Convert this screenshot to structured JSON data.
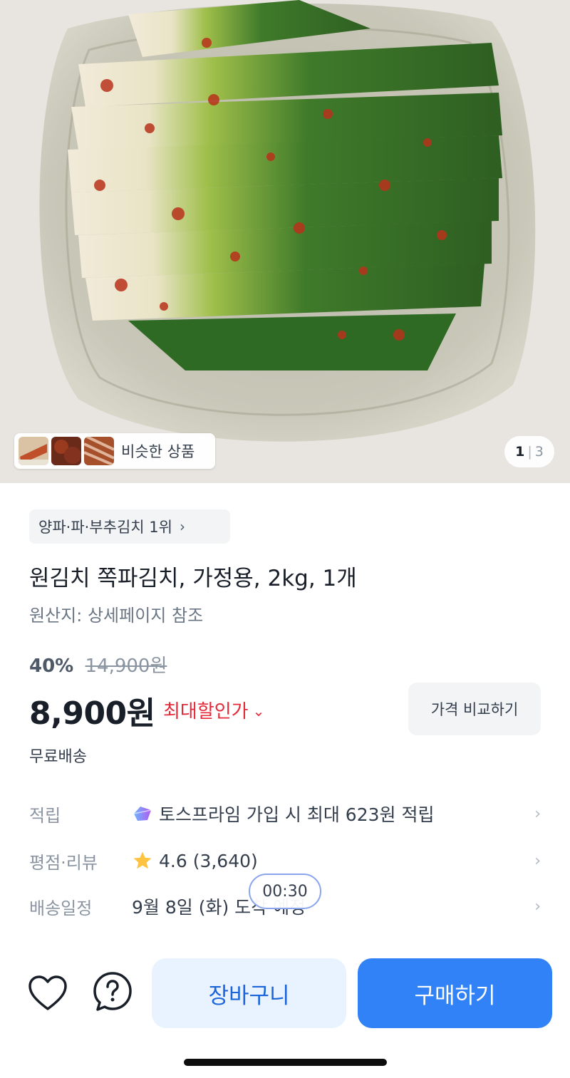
{
  "gallery": {
    "similar_label": "비슷한 상품",
    "current_index": "1",
    "separator": "|",
    "total": "3"
  },
  "product": {
    "category_rank": "양파·파·부추김치 1위",
    "title": "원김치 쪽파김치, 가정용, 2kg, 1개",
    "origin": "원산지: 상세페이지 참조",
    "discount_rate": "40%",
    "original_price": "14,900원",
    "price": "8,900원",
    "max_discount_label": "최대할인가",
    "compare_button": "가격 비교하기",
    "shipping": "무료배송"
  },
  "info_rows": [
    {
      "label": "적립",
      "value": "토스프라임 가입 시 최대 623원 적립",
      "icon": "toss-prime-gem-icon"
    },
    {
      "label": "평점·리뷰",
      "value": "4.6 (3,640)",
      "icon": "star-icon"
    },
    {
      "label": "배송일정",
      "value": "9월 8일 (화) 도착 예정",
      "icon": ""
    }
  ],
  "timer": "00:30",
  "bottom_bar": {
    "wishlist_icon": "heart-icon",
    "help_icon": "question-bubble-icon",
    "cart_label": "장바구니",
    "buy_label": "구매하기"
  },
  "colors": {
    "accent": "#3182f6",
    "cart_bg": "#e8f3ff",
    "sale_red": "#e42939"
  }
}
